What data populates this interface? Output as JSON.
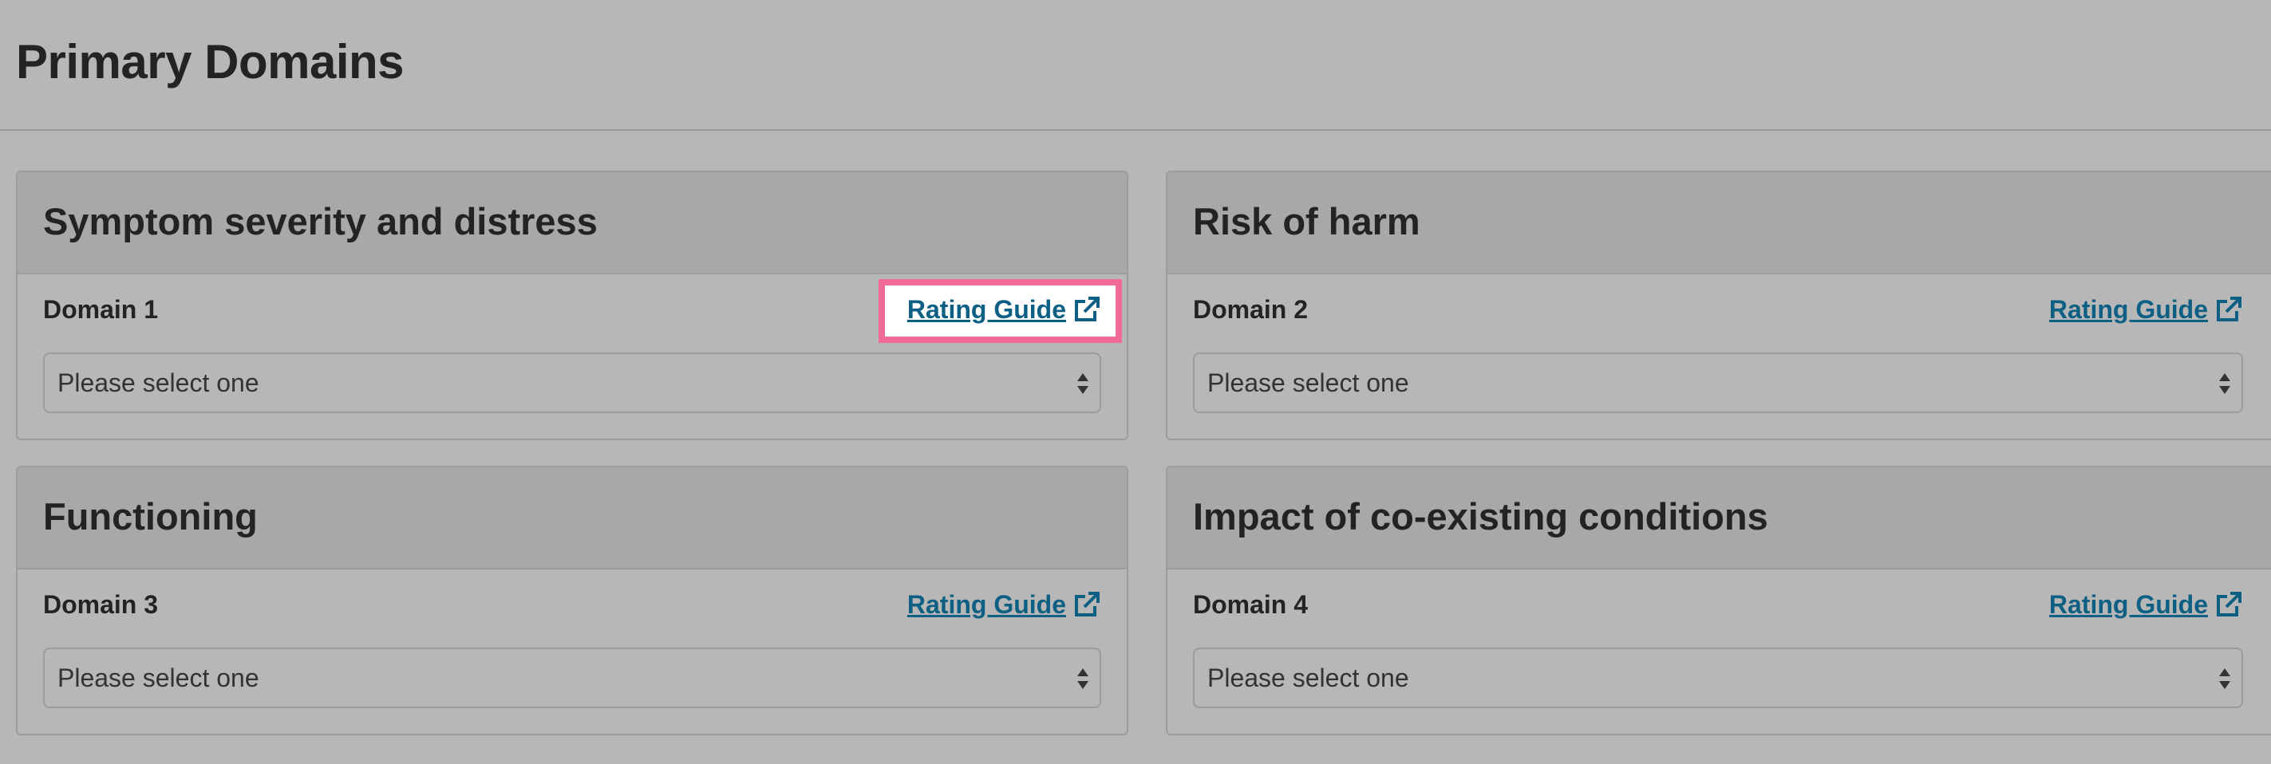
{
  "page": {
    "title": "Primary Domains"
  },
  "cards": [
    {
      "title": "Symptom severity and distress",
      "domain_label": "Domain 1",
      "guide_label": "Rating Guide",
      "select_placeholder": "Please select one",
      "highlighted": true
    },
    {
      "title": "Risk of harm",
      "domain_label": "Domain 2",
      "guide_label": "Rating Guide",
      "select_placeholder": "Please select one",
      "highlighted": false
    },
    {
      "title": "Functioning",
      "domain_label": "Domain 3",
      "guide_label": "Rating Guide",
      "select_placeholder": "Please select one",
      "highlighted": false
    },
    {
      "title": "Impact of co-existing conditions",
      "domain_label": "Domain 4",
      "guide_label": "Rating Guide",
      "select_placeholder": "Please select one",
      "highlighted": false
    }
  ],
  "icons": {
    "guide": "external-link-icon",
    "select": "select-arrows-icon"
  },
  "colors": {
    "link": "#0e5f84",
    "highlight_border": "#f06b9a",
    "card_header": "#a8a8a8",
    "page_background": "#b7b7b7"
  }
}
